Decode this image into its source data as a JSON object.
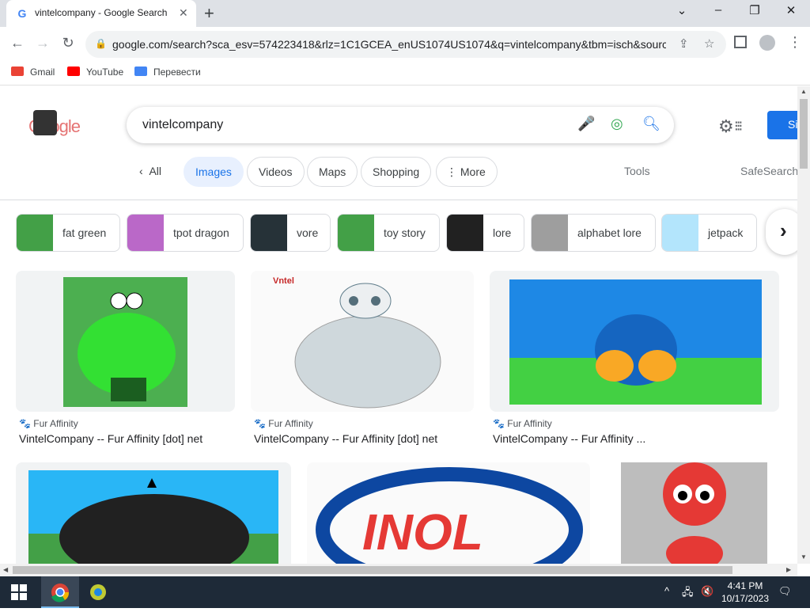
{
  "browser": {
    "tab_title": "vintelcompany - Google Search",
    "tab_favicon": "G",
    "url": "google.com/search?sca_esv=574223418&rlz=1C1GCEA_enUS1074US1074&q=vintelcompany&tbm=isch&sourc...",
    "bookmarks": [
      {
        "label": "Gmail",
        "color": "#ea4335"
      },
      {
        "label": "YouTube",
        "color": "#ff0000"
      },
      {
        "label": "Перевести",
        "color": "#4285f4"
      }
    ]
  },
  "search": {
    "query": "vintelcompany",
    "logo_text": "Google",
    "signin_label": "Si"
  },
  "filters": {
    "all": "All",
    "tabs": [
      "Images",
      "Videos",
      "Maps",
      "Shopping",
      "More"
    ],
    "active": "Images",
    "tools": "Tools",
    "safesearch": "SafeSearch"
  },
  "chips": [
    {
      "label": "fat green",
      "color": "#2e7d32"
    },
    {
      "label": "tpot dragon",
      "color": "#ba68c8"
    },
    {
      "label": "vore",
      "color": "#263238"
    },
    {
      "label": "toy story",
      "color": "#43a047"
    },
    {
      "label": "lore",
      "color": "#212121"
    },
    {
      "label": "alphabet lore",
      "color": "#9e9e9e"
    },
    {
      "label": "jetpack",
      "color": "#b3e5fc"
    }
  ],
  "results": [
    {
      "source": "Fur Affinity",
      "caption": "VintelCompany -- Fur Affinity [dot] net"
    },
    {
      "source": "Fur Affinity",
      "caption": "VintelCompany -- Fur Affinity [dot] net"
    },
    {
      "source": "Fur Affinity",
      "caption": "VintelCompany -- Fur Affinity ..."
    }
  ],
  "taskbar": {
    "time": "4:41 PM",
    "date": "10/17/2023"
  },
  "colors": {
    "accent": "#1a73e8",
    "active_tab_bg": "#e8f0fe"
  }
}
